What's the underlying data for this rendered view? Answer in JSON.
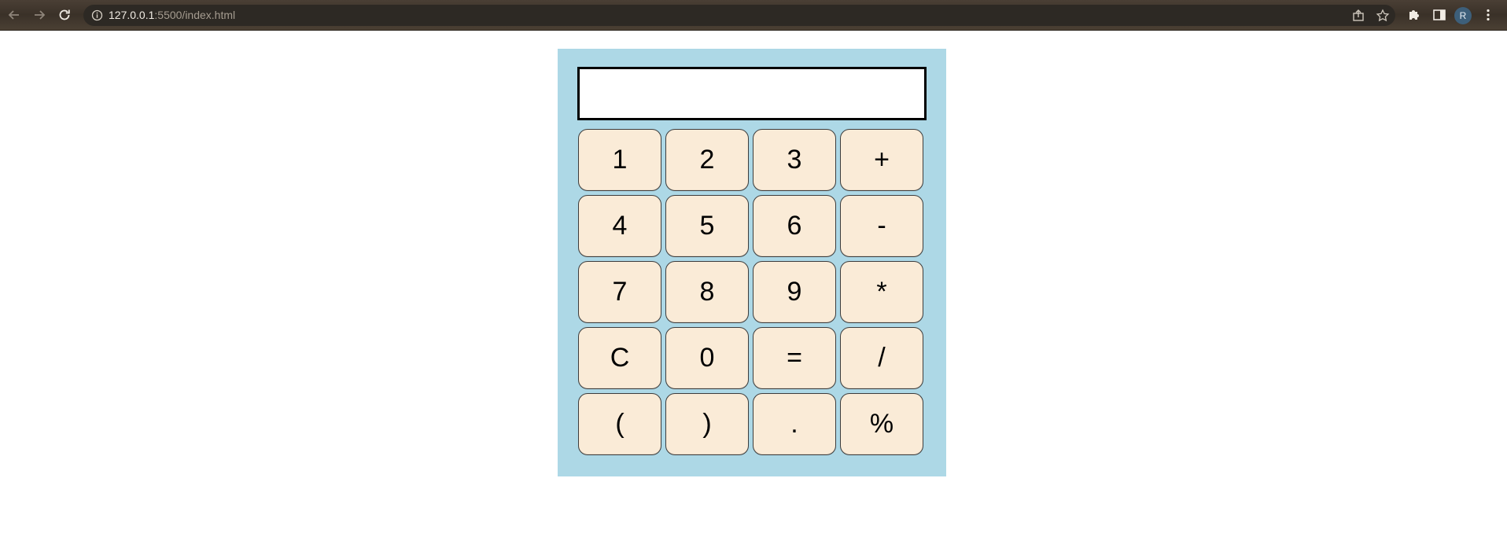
{
  "browser": {
    "url_host": "127.0.0.1",
    "url_rest": ":5500/index.html",
    "avatar_letter": "R",
    "icons": [
      "back-arrow-icon",
      "forward-arrow-icon",
      "reload-icon",
      "info-icon",
      "share-icon",
      "star-icon",
      "extensions-puzzle-icon",
      "side-panel-icon",
      "kebab-menu-icon"
    ]
  },
  "calculator": {
    "display_value": "",
    "keys": [
      {
        "label": "1",
        "name": "key-1"
      },
      {
        "label": "2",
        "name": "key-2"
      },
      {
        "label": "3",
        "name": "key-3"
      },
      {
        "label": "+",
        "name": "key-plus"
      },
      {
        "label": "4",
        "name": "key-4"
      },
      {
        "label": "5",
        "name": "key-5"
      },
      {
        "label": "6",
        "name": "key-6"
      },
      {
        "label": "-",
        "name": "key-minus"
      },
      {
        "label": "7",
        "name": "key-7"
      },
      {
        "label": "8",
        "name": "key-8"
      },
      {
        "label": "9",
        "name": "key-9"
      },
      {
        "label": "*",
        "name": "key-multiply"
      },
      {
        "label": "C",
        "name": "key-clear"
      },
      {
        "label": "0",
        "name": "key-0"
      },
      {
        "label": "=",
        "name": "key-equals"
      },
      {
        "label": "/",
        "name": "key-divide"
      },
      {
        "label": "(",
        "name": "key-open-paren"
      },
      {
        "label": ")",
        "name": "key-close-paren"
      },
      {
        "label": ".",
        "name": "key-decimal"
      },
      {
        "label": "%",
        "name": "key-percent"
      }
    ]
  },
  "colors": {
    "calculator_bg": "#add8e6",
    "key_bg": "#faebd7",
    "display_border": "#000000"
  }
}
